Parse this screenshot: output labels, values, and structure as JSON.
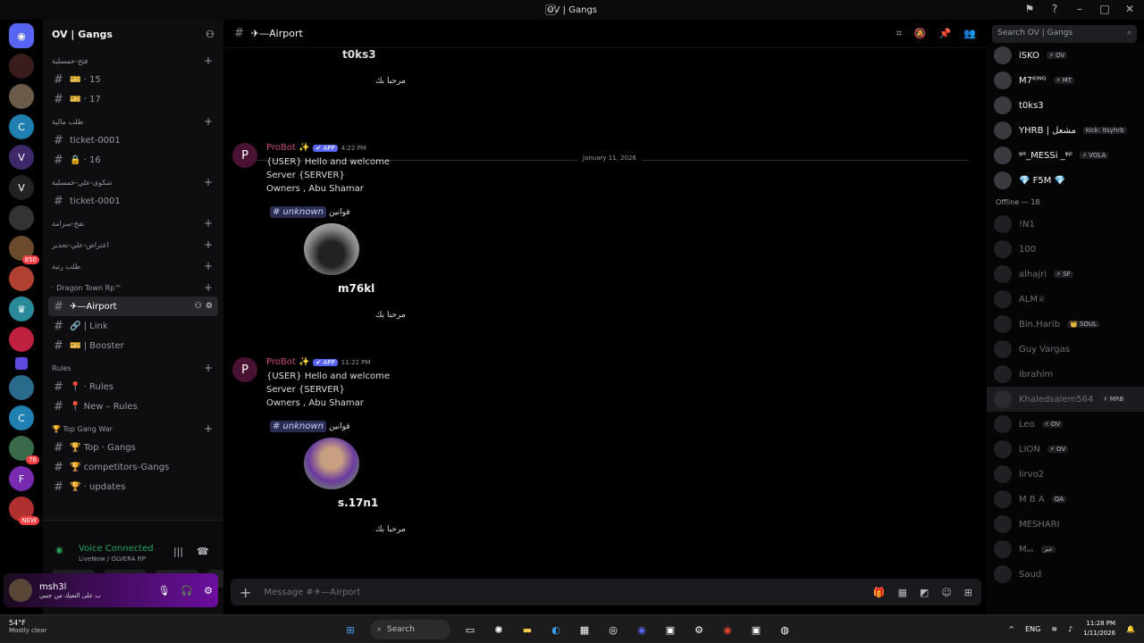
{
  "window": {
    "title": "OV | Gangs"
  },
  "server": {
    "name": "OV | Gangs"
  },
  "channel_header": {
    "name": "✈—Airport",
    "search_placeholder": "Search OV | Gangs"
  },
  "channels": [
    {
      "type": "cat",
      "label": "فتح-خمسلية"
    },
    {
      "type": "ch",
      "label": "🎫 · 15"
    },
    {
      "type": "ch",
      "label": "🎫 · 17"
    },
    {
      "type": "cat",
      "label": "طلب مالية"
    },
    {
      "type": "ch",
      "label": "ticket-0001"
    },
    {
      "type": "ch",
      "label": "🔒 · 16"
    },
    {
      "type": "cat",
      "label": "شكوى-علي-خمسلية"
    },
    {
      "type": "ch",
      "label": "ticket-0001"
    },
    {
      "type": "cat",
      "label": "نفخ-سرامة"
    },
    {
      "type": "cat",
      "label": "اعتراض-علي-تحذير"
    },
    {
      "type": "cat",
      "label": "طلب رتبة"
    },
    {
      "type": "cat",
      "label": "· Dragon Town Rp™"
    },
    {
      "type": "ch",
      "label": "✈—Airport",
      "active": true
    },
    {
      "type": "ch",
      "label": "🔗 | Link"
    },
    {
      "type": "ch",
      "label": "🎫 | Booster"
    },
    {
      "type": "cat",
      "label": "Rules"
    },
    {
      "type": "ch",
      "label": "📍 · Rules"
    },
    {
      "type": "ch",
      "label": "📍 New – Rules"
    },
    {
      "type": "cat",
      "label": "🏆 Top Gang War"
    },
    {
      "type": "ch",
      "label": "🏆 Top · Gangs"
    },
    {
      "type": "ch",
      "label": "🏆 competitors-Gangs"
    },
    {
      "type": "ch",
      "label": "🏆 · updates"
    }
  ],
  "voice": {
    "status": "Voice Connected",
    "sub": "LiveNow / OLVERA RP"
  },
  "user": {
    "name": "msh3l",
    "status": "ب على التعيك من جنبي"
  },
  "messages": {
    "top_name": "t0ks3",
    "welcome": "مرحبا بك",
    "date_divider": "January 11, 2026",
    "posts": [
      {
        "bot": "ProBot ✨",
        "app": "✔ APP",
        "time": "4:22 PM",
        "line1": "{USER} Hello and welcome",
        "line2": "Server {SERVER}",
        "line3": "Owners , Abu Shamar",
        "tag": "# unknown",
        "rules": "قوانين",
        "pname": "m76kl",
        "welcome": "مرحبا بك"
      },
      {
        "bot": "ProBot ✨",
        "app": "✔ APP",
        "time": "11:22 PM",
        "line1": "{USER} Hello and welcome",
        "line2": "Server {SERVER}",
        "line3": "Owners , Abu Shamar",
        "tag": "# unknown",
        "rules": "قوانين",
        "pname": "s.17n1",
        "welcome": "مرحبا بك"
      }
    ]
  },
  "composer": {
    "placeholder": "Message #✈—Airport"
  },
  "members_online": [
    {
      "name": "iSKO",
      "tag": "⚡ OV"
    },
    {
      "name": "M7ᴷᴵᴺᴳ",
      "tag": "⚡ MT"
    },
    {
      "name": "t0ks3",
      "tag": ""
    },
    {
      "name": "YHRB | مشعل",
      "tag": "kick: itsyhrb"
    },
    {
      "name": "ᵠᵃ_MESSi _ᵠᵖ",
      "tag": "⚡ VOLA"
    },
    {
      "name": "💎 F5M 💎",
      "tag": ""
    }
  ],
  "offline_header": "Offline — 18",
  "members_offline": [
    {
      "name": "!N1",
      "tag": ""
    },
    {
      "name": "100",
      "tag": ""
    },
    {
      "name": "alhajri",
      "tag": "⚡ SF"
    },
    {
      "name": "ALM♕",
      "tag": ""
    },
    {
      "name": "Bin.Harib",
      "tag": "👑 SOUL"
    },
    {
      "name": "Guy Vargas",
      "tag": ""
    },
    {
      "name": "ibrahim",
      "tag": ""
    },
    {
      "name": "Khaledsalem564",
      "tag": "⚡ MRB"
    },
    {
      "name": "Leo",
      "tag": "⚡ OV"
    },
    {
      "name": "LION",
      "tag": "⚡ OV"
    },
    {
      "name": "lirvo2",
      "tag": ""
    },
    {
      "name": "M B A",
      "tag": "QA"
    },
    {
      "name": "MESHARI",
      "tag": ""
    },
    {
      "name": "Mᵤₒ",
      "tag": "عنز"
    },
    {
      "name": "Saud",
      "tag": ""
    }
  ],
  "taskbar": {
    "temp": "54°F",
    "weather": "Mostly clear",
    "search": "Search",
    "lang": "ENG",
    "time": "11:28 PM",
    "date": "1/11/2026"
  }
}
